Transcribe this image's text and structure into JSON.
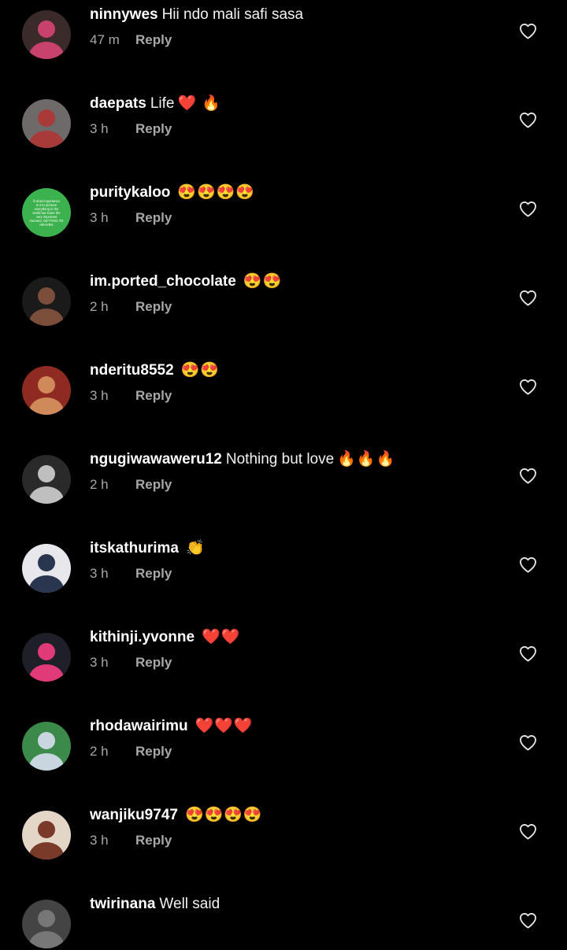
{
  "colors": {
    "background": "#000000",
    "text": "#ffffff",
    "meta": "#a8a8a8"
  },
  "comments": [
    {
      "username": "ninnywes",
      "text": "Hii ndo mali safi sasa",
      "emojis": "",
      "time": "47 m",
      "reply": "Reply",
      "avatar_colors": [
        "#3a2a2a",
        "#c7436e"
      ],
      "like_icon": "heart-outline-icon"
    },
    {
      "username": "daepats",
      "text": "Life",
      "emojis": "❤️ 🔥",
      "time": "3 h",
      "reply": "Reply",
      "avatar_colors": [
        "#6e6a6a",
        "#a83a3a"
      ],
      "like_icon": "heart-outline-icon"
    },
    {
      "username": "puritykaloo",
      "text": "",
      "emojis": "😍😍😍😍",
      "time": "3 h",
      "reply": "Reply",
      "avatar_colors": [
        "#3bb24d",
        "#2b8a3a"
      ],
      "avatar_text": "if what importance is it to achieve everything in the world but loose the very important moment, GETTING TO HEAVEN",
      "like_icon": "heart-outline-icon"
    },
    {
      "username": "im.ported_chocolate",
      "text": "",
      "emojis": "😍😍",
      "time": "2 h",
      "reply": "Reply",
      "avatar_colors": [
        "#1a1a1a",
        "#7a4e3a"
      ],
      "like_icon": "heart-outline-icon"
    },
    {
      "username": "nderitu8552",
      "text": "",
      "emojis": "😍😍",
      "time": "3 h",
      "reply": "Reply",
      "avatar_colors": [
        "#8e2a22",
        "#d08a5a"
      ],
      "like_icon": "heart-outline-icon"
    },
    {
      "username": "ngugiwawaweru12",
      "text": "Nothing but love",
      "emojis": "🔥🔥🔥",
      "time": "2 h",
      "reply": "Reply",
      "avatar_colors": [
        "#2a2a2a",
        "#bfbfbf"
      ],
      "like_icon": "heart-outline-icon"
    },
    {
      "username": "itskathurima",
      "text": "",
      "emojis": "👏",
      "time": "3 h",
      "reply": "Reply",
      "avatar_colors": [
        "#e8e8ec",
        "#2a3550"
      ],
      "like_icon": "heart-outline-icon"
    },
    {
      "username": "kithinji.yvonne",
      "text": "",
      "emojis": "❤️❤️",
      "time": "3 h",
      "reply": "Reply",
      "avatar_colors": [
        "#1f1f2a",
        "#e03a78"
      ],
      "like_icon": "heart-outline-icon"
    },
    {
      "username": "rhodawairimu",
      "text": "",
      "emojis": "❤️❤️❤️",
      "time": "2 h",
      "reply": "Reply",
      "avatar_colors": [
        "#3c8a4a",
        "#c9d6e0"
      ],
      "like_icon": "heart-outline-icon"
    },
    {
      "username": "wanjiku9747",
      "text": "",
      "emojis": "😍😍😍😍",
      "time": "3 h",
      "reply": "Reply",
      "avatar_colors": [
        "#e4d6c6",
        "#7a3a2a"
      ],
      "like_icon": "heart-outline-icon"
    },
    {
      "username": "twirinana",
      "text": "Well said",
      "emojis": "",
      "time": "",
      "reply": "",
      "avatar_colors": [
        "#444444",
        "#777777"
      ],
      "like_icon": "heart-outline-icon"
    }
  ]
}
